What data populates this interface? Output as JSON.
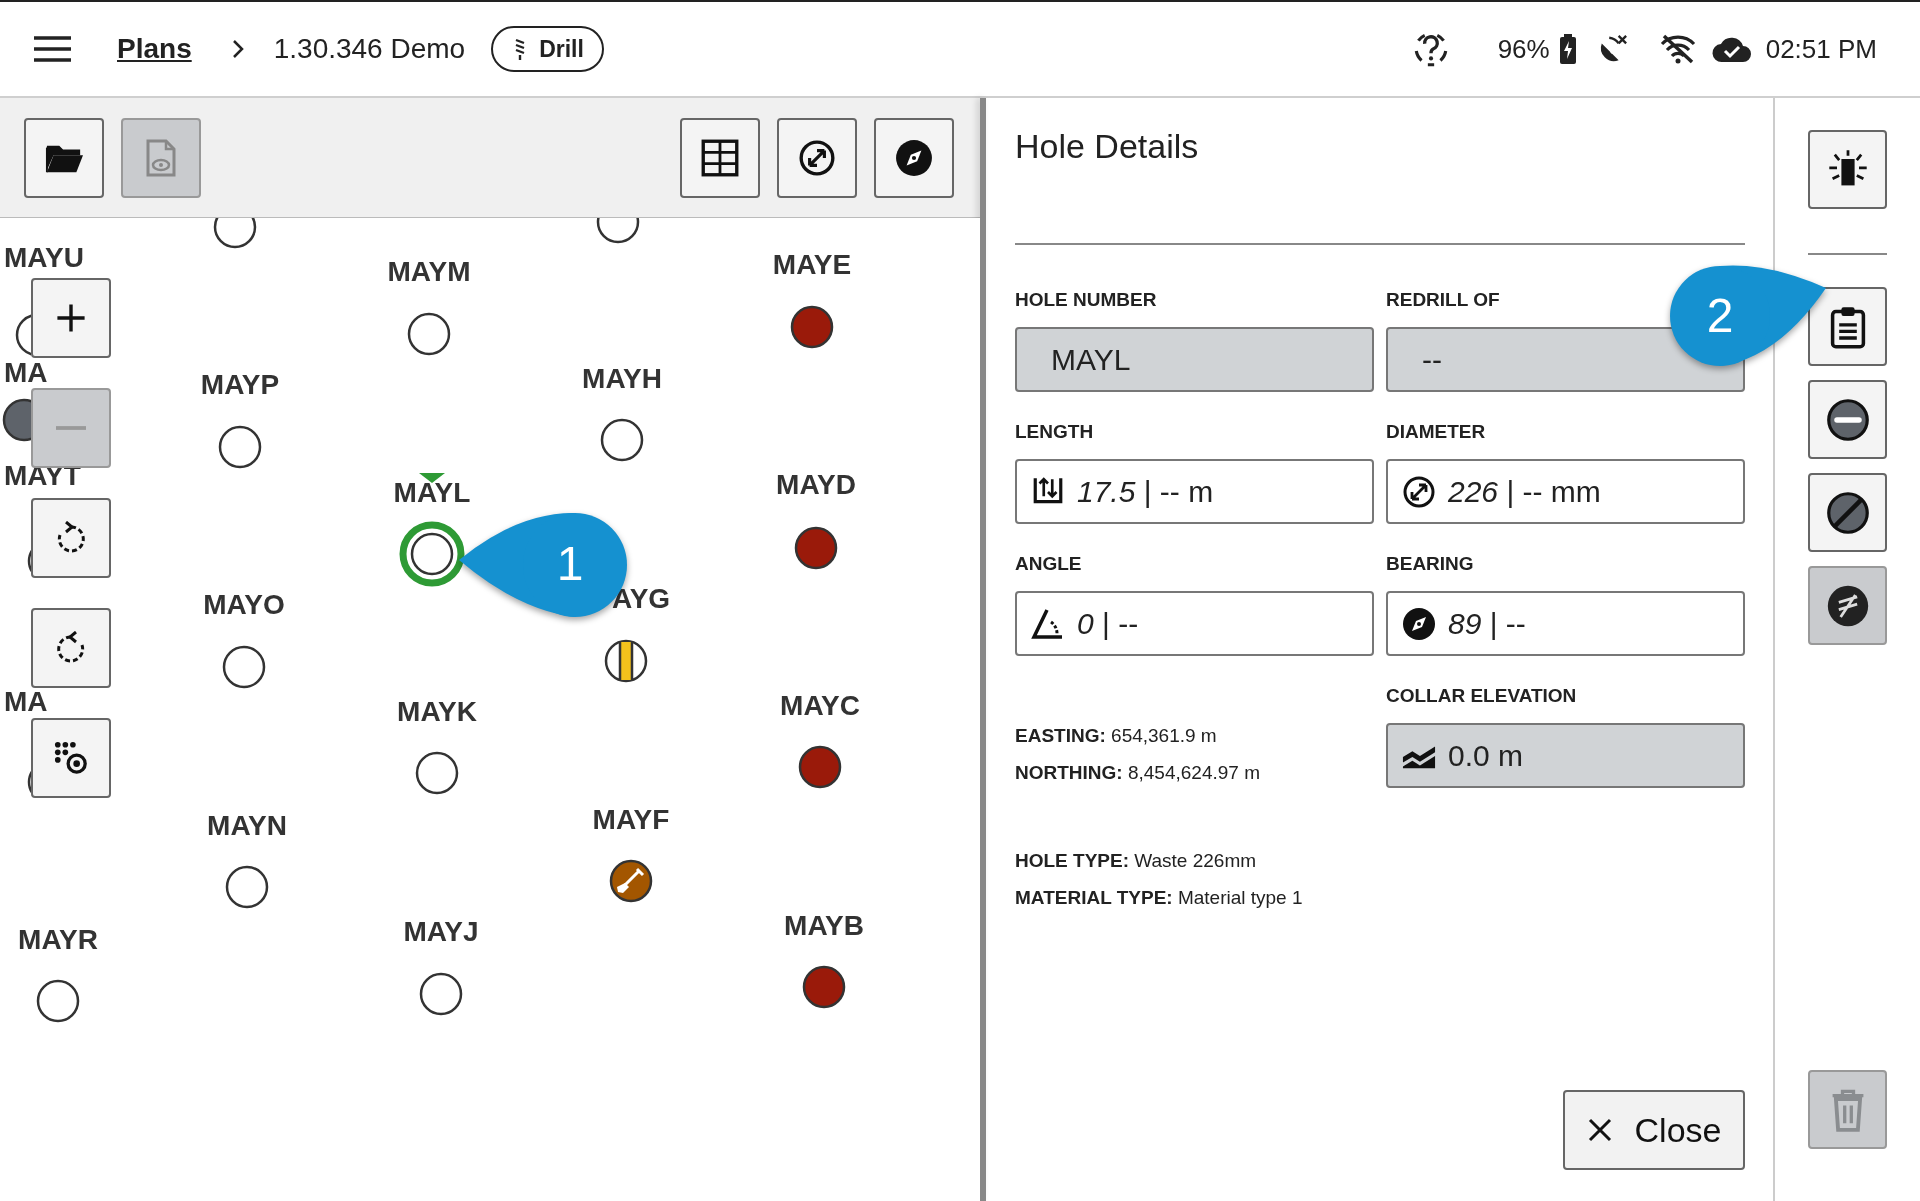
{
  "top_bar": {
    "breadcrumb": [
      {
        "label": "Plans",
        "kind": "link"
      },
      {
        "label": "1.30.346 Demo",
        "kind": "text"
      }
    ],
    "mode_chip": "Drill",
    "battery": "96%",
    "time": "02:51 PM"
  },
  "map": {
    "toolbar": [
      {
        "disabled": false
      },
      {
        "disabled": true
      },
      {
        "disabled": false
      },
      {
        "disabled": false
      },
      {
        "disabled": false
      }
    ],
    "controls": [
      {
        "disabled": false
      },
      {
        "disabled": true
      },
      {
        "disabled": false
      },
      {
        "disabled": false
      },
      {
        "disabled": false
      }
    ],
    "holes": [
      {
        "kind": "open",
        "selected": false
      },
      {
        "kind": "open",
        "selected": false
      },
      {
        "label": "MAYU",
        "kind": "open",
        "selected": false
      },
      {
        "label": "MAYM",
        "kind": "open",
        "selected": false
      },
      {
        "label": "MAYE",
        "kind": "drilled",
        "selected": false
      },
      {
        "label": "MA",
        "kind": "inactive",
        "selected": false
      },
      {
        "label": "MAYP",
        "kind": "open",
        "selected": false
      },
      {
        "label": "MAYH",
        "kind": "open",
        "selected": false
      },
      {
        "label": "MAYT",
        "kind": "open",
        "selected": false
      },
      {
        "label": "MAYL",
        "kind": "open",
        "selected": true
      },
      {
        "label": "MAYD",
        "kind": "drilled",
        "selected": false
      },
      {
        "label": "MAYO",
        "kind": "open",
        "selected": false
      },
      {
        "label": "AYG",
        "kind": "partial",
        "selected": false
      },
      {
        "label": "MA",
        "kind": "open",
        "selected": false
      },
      {
        "label": "MAYK",
        "kind": "open",
        "selected": false
      },
      {
        "label": "MAYC",
        "kind": "drilled",
        "selected": false
      },
      {
        "label": "MAYN",
        "kind": "open",
        "selected": false
      },
      {
        "label": "MAYF",
        "kind": "sampled",
        "selected": false
      },
      {
        "label": "MAYR",
        "kind": "open",
        "selected": false
      },
      {
        "label": "MAYJ",
        "kind": "open",
        "selected": false
      },
      {
        "label": "MAYB",
        "kind": "drilled",
        "selected": false
      }
    ]
  },
  "callouts": [
    "1",
    "2"
  ],
  "details": {
    "title": "Hole Details",
    "fields": [
      {
        "label": "HOLE NUMBER",
        "value": "MAYL",
        "kind": "readonly"
      },
      {
        "label": "REDRILL OF",
        "value": "--",
        "kind": "readonly"
      },
      {
        "label": "LENGTH",
        "value": "*17.5* | -- m",
        "kind": "input"
      },
      {
        "label": "DIAMETER",
        "value": "*226* | -- mm",
        "kind": "input"
      },
      {
        "label": "ANGLE",
        "value": "*0* | --",
        "kind": "input"
      },
      {
        "label": "BEARING",
        "value": "*89* | --",
        "kind": "input"
      },
      {
        "label": "COLLAR ELEVATION",
        "value": "0.0 m",
        "kind": "readonly"
      }
    ],
    "coordinates": [
      "**EASTING:** 654,361.9 m",
      "**NORTHING:** 8,454,624.97 m"
    ],
    "properties": [
      "**HOLE TYPE:** Waste 226mm",
      "**MATERIAL TYPE:** Material type 1"
    ],
    "close_button": "Close"
  },
  "side_toolbar": [
    {
      "disabled": false
    },
    {
      "disabled": false
    },
    {
      "disabled": false
    },
    {
      "disabled": false
    },
    {
      "disabled": true
    },
    {
      "disabled": true
    }
  ]
}
